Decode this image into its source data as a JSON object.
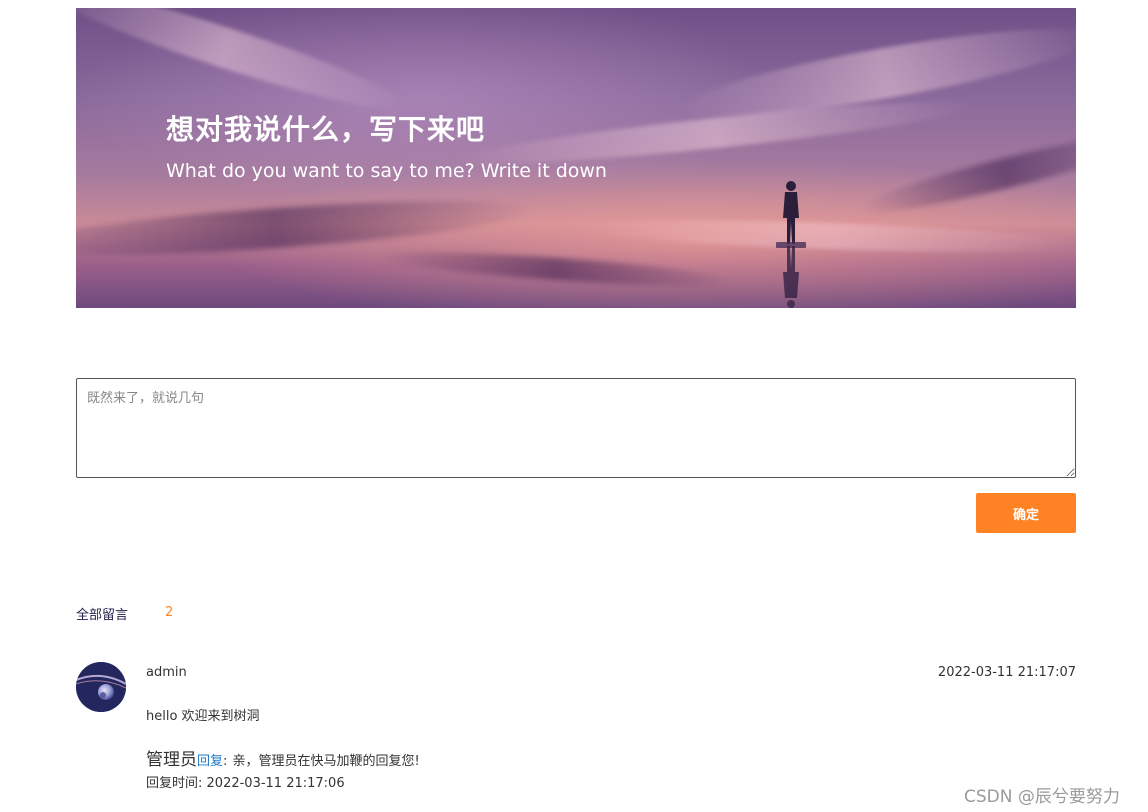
{
  "banner": {
    "title": "想对我说什么，写下来吧",
    "subtitle": "What do you want to say to me? Write it down"
  },
  "message_form": {
    "placeholder": "既然来了，就说几句",
    "value": "",
    "submit_label": "确定"
  },
  "comments": {
    "label": "全部留言",
    "count": "2",
    "items": [
      {
        "user": "admin",
        "time": "2022-03-11 21:17:07",
        "text": "hello 欢迎来到树洞",
        "reply": {
          "author": "管理员",
          "action": "回复",
          "separator": ":",
          "content": "亲，管理员在快马加鞭的回复您!",
          "time_label": "回复时间:",
          "time": "2022-03-11 21:17:06"
        }
      }
    ]
  },
  "watermark": "CSDN @辰兮要努力",
  "colors": {
    "accent": "#ff8224",
    "link": "#1e78c8",
    "text": "#333333"
  }
}
